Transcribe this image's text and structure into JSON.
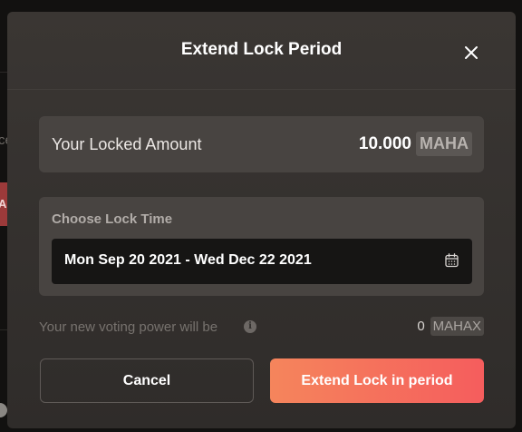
{
  "modal": {
    "title": "Extend Lock Period",
    "close_icon": "close-icon"
  },
  "locked": {
    "label": "Your Locked Amount",
    "value": "10.000",
    "token": "MAHA"
  },
  "lock_time": {
    "label": "Choose Lock Time",
    "date_range": "Mon Sep 20 2021 - Wed Dec 22 2021",
    "icon": "calendar-icon"
  },
  "voting": {
    "label": "Your new voting power will be",
    "info_icon": "info-icon",
    "value": "0",
    "token": "MAHAX"
  },
  "actions": {
    "cancel_label": "Cancel",
    "primary_label": "Extend Lock in period"
  },
  "background": {
    "left_text": "ce",
    "red_button_text": "A"
  },
  "colors": {
    "primary_gradient_start": "#f5855c",
    "primary_gradient_end": "#f55d5d",
    "modal_bg": "#3a3633",
    "card_bg": "#484441",
    "input_bg": "#161514"
  }
}
